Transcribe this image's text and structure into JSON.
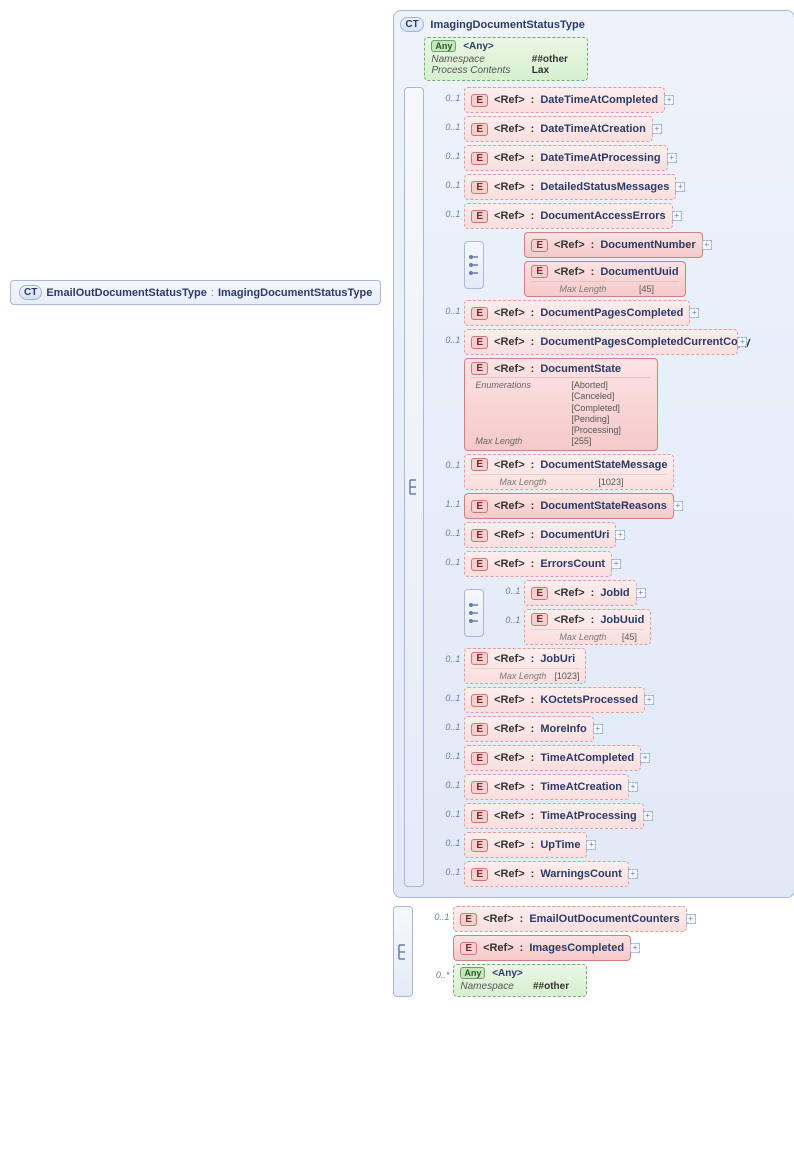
{
  "root": {
    "badge": "CT",
    "name": "EmailOutDocumentStatusType",
    "base": "ImagingDocumentStatusType"
  },
  "panel": {
    "badge": "CT",
    "title": "ImagingDocumentStatusType"
  },
  "any": {
    "badge": "Any",
    "tag": "<Any>",
    "rows": [
      {
        "k": "Namespace",
        "v": "##other"
      },
      {
        "k": "Process Contents",
        "v": "Lax"
      }
    ]
  },
  "refLabel": "<Ref>",
  "eBadge": "E",
  "items": [
    {
      "occ": "0..1",
      "name": "DateTimeAtCompleted"
    },
    {
      "occ": "0..1",
      "name": "DateTimeAtCreation"
    },
    {
      "occ": "0..1",
      "name": "DateTimeAtProcessing"
    },
    {
      "occ": "0..1",
      "name": "DetailedStatusMessages"
    },
    {
      "occ": "0..1",
      "name": "DocumentAccessErrors"
    }
  ],
  "docChoice": {
    "a": {
      "occ": "",
      "name": "DocumentNumber"
    },
    "b": {
      "occ": "",
      "name": "DocumentUuid",
      "metaK": "Max Length",
      "metaV": "[45]"
    }
  },
  "items2": [
    {
      "occ": "0..1",
      "name": "DocumentPagesCompleted"
    },
    {
      "occ": "0..1",
      "name": "DocumentPagesCompletedCurrentCopy",
      "wide": true
    }
  ],
  "stateCard": {
    "name": "DocumentState",
    "enumK": "Enumerations",
    "enums": [
      "[Aborted]",
      "[Canceled]",
      "[Completed]",
      "[Pending]",
      "[Processing]"
    ],
    "maxK": "Max Length",
    "maxV": "[255]"
  },
  "items3": [
    {
      "occ": "0..1",
      "name": "DocumentStateMessage",
      "metaK": "Max Length",
      "metaV": "[1023]"
    },
    {
      "occ": "1..1",
      "name": "DocumentStateReasons",
      "req": true
    },
    {
      "occ": "0..1",
      "name": "DocumentUri"
    },
    {
      "occ": "0..1",
      "name": "ErrorsCount"
    }
  ],
  "jobChoice": {
    "a": {
      "occ": "0..1",
      "name": "JobId"
    },
    "b": {
      "occ": "0..1",
      "name": "JobUuid",
      "metaK": "Max Length",
      "metaV": "[45]"
    }
  },
  "items4": [
    {
      "occ": "0..1",
      "name": "JobUri",
      "metaK": "Max Length",
      "metaV": "[1023]"
    },
    {
      "occ": "0..1",
      "name": "KOctetsProcessed"
    },
    {
      "occ": "0..1",
      "name": "MoreInfo"
    },
    {
      "occ": "0..1",
      "name": "TimeAtCompleted"
    },
    {
      "occ": "0..1",
      "name": "TimeAtCreation"
    },
    {
      "occ": "0..1",
      "name": "TimeAtProcessing"
    },
    {
      "occ": "0..1",
      "name": "UpTime"
    },
    {
      "occ": "0..1",
      "name": "WarningsCount"
    }
  ],
  "bottom": {
    "items": [
      {
        "occ": "0..1",
        "name": "EmailOutDocumentCounters"
      },
      {
        "occ": "",
        "name": "ImagesCompleted",
        "req": true
      }
    ],
    "any": {
      "occ": "0..*",
      "badge": "Any",
      "tag": "<Any>",
      "rowK": "Namespace",
      "rowV": "##other"
    }
  }
}
